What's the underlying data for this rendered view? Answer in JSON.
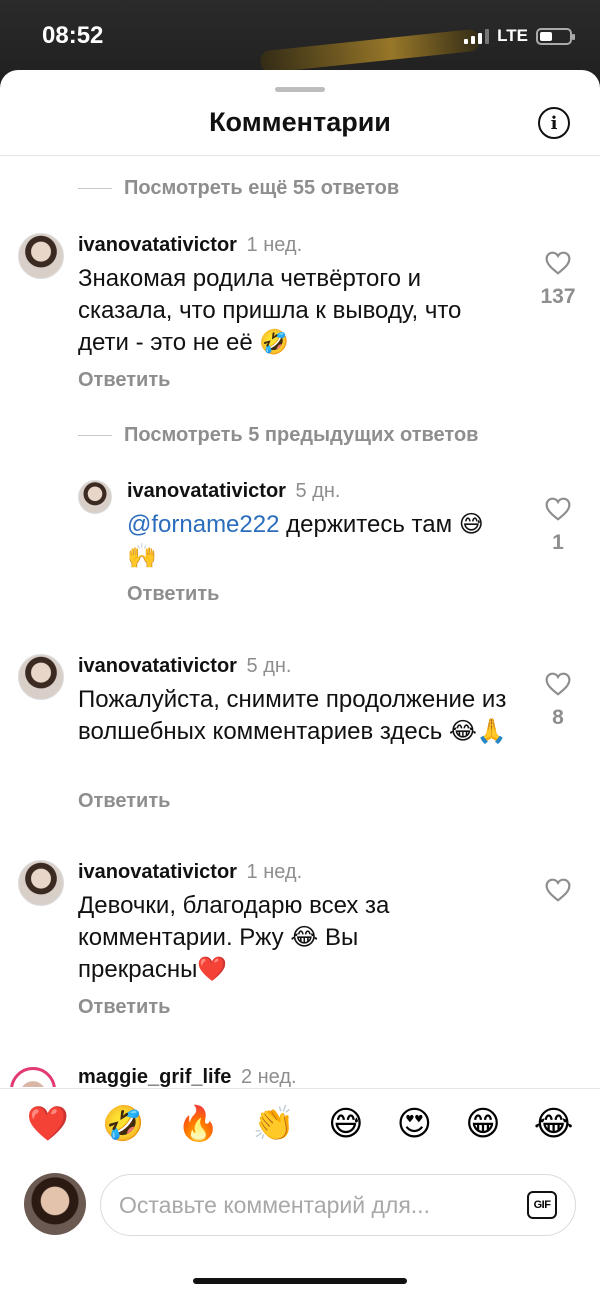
{
  "status": {
    "time": "08:52",
    "network": "LTE",
    "battery_level": 0.35
  },
  "header": {
    "title": "Комментарии",
    "info_icon": "info-icon"
  },
  "view_more_top": "Посмотреть ещё 55 ответов",
  "view_more_mid": "Посмотреть 5 предыдущих ответов",
  "comments": [
    {
      "user": "ivanovatativictor",
      "time": "1 нед.",
      "text": "Знакомая родила четвёртого и сказала, что пришла к выводу, что дети - это не её 🤣",
      "reply": "Ответить",
      "likes": "137"
    },
    {
      "user": "ivanovatativictor",
      "time": "5 дн.",
      "mention": "@forname222",
      "text": " держитесь там 😅🙌",
      "reply": "Ответить",
      "likes": "1"
    },
    {
      "user": "ivanovatativictor",
      "time": "5 дн.",
      "text": "Пожалуйста, снимите продолжение из волшебных комментариев здесь 😂🙏",
      "reply": "Ответить",
      "likes": "8"
    },
    {
      "user": "ivanovatativictor",
      "time": "1 нед.",
      "text": "Девочки, благодарю всех за комментарии. Ржу 😂 Вы прекрасны❤️",
      "reply": "Ответить",
      "likes": ""
    },
    {
      "user": "maggie_grif_life",
      "time": "2 нед."
    }
  ],
  "emoji_bar": [
    "❤️",
    "🤣",
    "🔥",
    "👏",
    "😅",
    "😍",
    "😁",
    "😂"
  ],
  "compose": {
    "placeholder": "Оставьте комментарий для...",
    "gif_label": "GIF"
  }
}
